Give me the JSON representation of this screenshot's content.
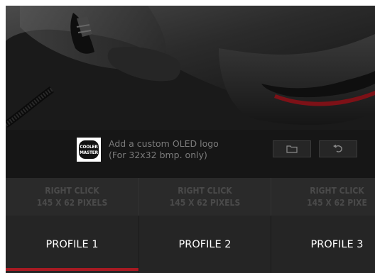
{
  "oled": {
    "prompt_line1": "Add a custom OLED logo",
    "prompt_line2": "(For 32x32 bmp. only)",
    "logo_line1": "COOLER",
    "logo_line2": "MASTER",
    "folder_icon": "folder-icon",
    "reset_icon": "undo-icon"
  },
  "cells": [
    {
      "line1": "RIGHT CLICK",
      "line2": "145 x 62 PIXELS"
    },
    {
      "line1": "RIGHT CLICK",
      "line2": "145 x 62 PIXELS"
    },
    {
      "line1": "RIGHT CLICK",
      "line2": "145 x 62 PIXE"
    }
  ],
  "tabs": [
    {
      "label": "PROFILE 1",
      "active": true
    },
    {
      "label": "PROFILE 2",
      "active": false
    },
    {
      "label": "PROFILE 3",
      "active": false
    }
  ],
  "colors": {
    "accent": "#a81a22",
    "background": "#151515",
    "muted_text": "#7c7c7c"
  }
}
